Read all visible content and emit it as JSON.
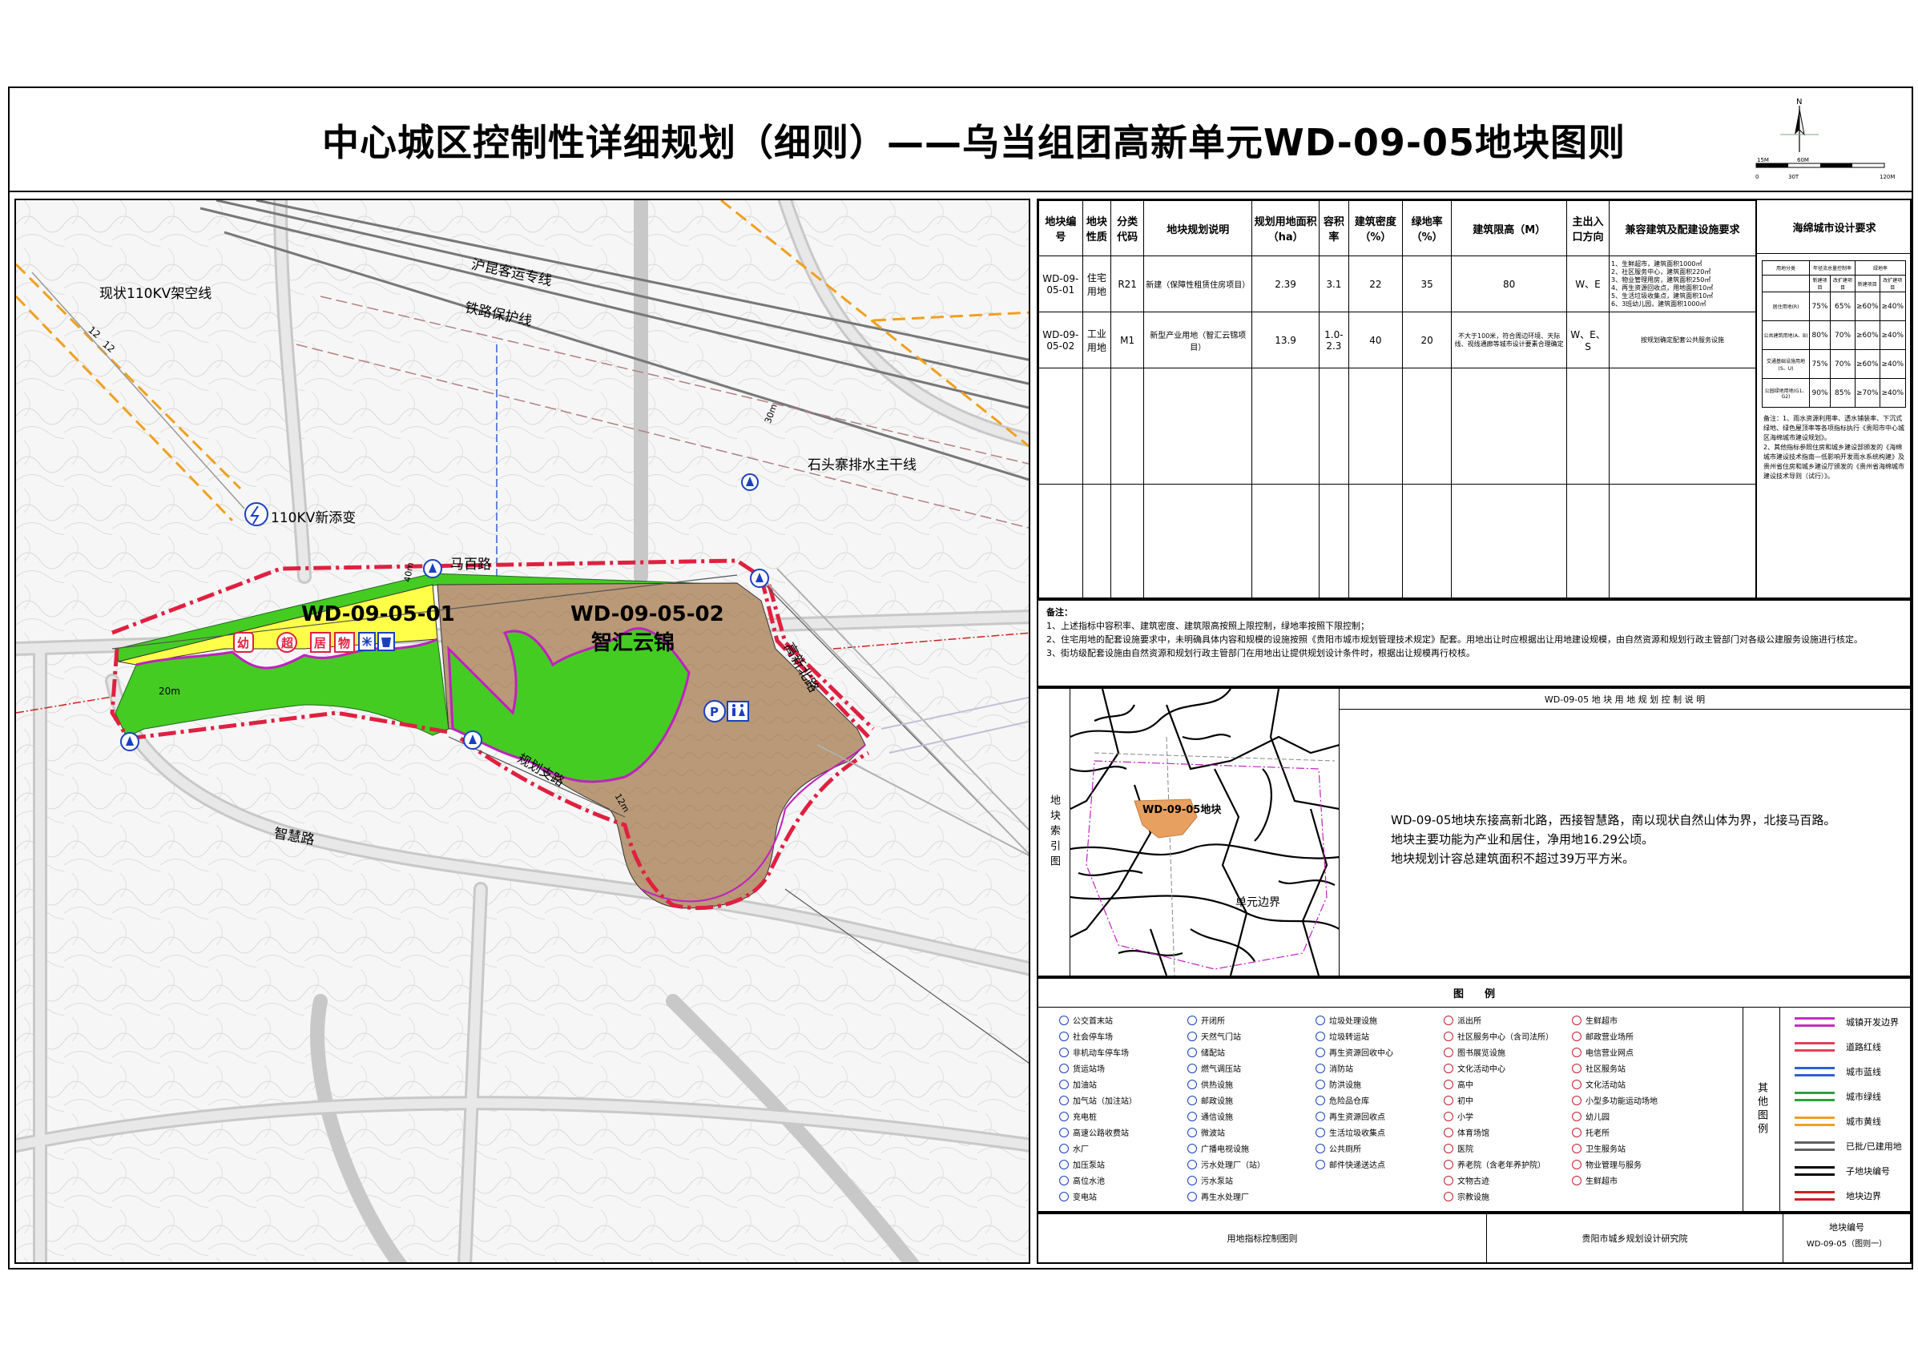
{
  "title": "中心城区控制性详细规划（细则）——乌当组团高新单元WD-09-05地块图则",
  "compass": {
    "north": "N",
    "scale_labels": [
      "15M",
      "60M",
      "0",
      "30T",
      "120M"
    ]
  },
  "map_labels": {
    "railway_passenger": "沪昆客运专线",
    "railway_protection": "铁路保护线",
    "powerline": "现状110KV架空线",
    "powerline_width_a": "12",
    "powerline_width_b": "12",
    "substation": "110KV新添变",
    "drainage": "石头寨排水主干线",
    "road_mabai": "马百路",
    "road_mabai_width": "40m",
    "road_gaoxin": "高新北路",
    "road_gaoxin_width": "30m",
    "road_zhihui": "智慧路",
    "road_zhihui_width": "20m",
    "road_guihua": "规划支路",
    "road_guihua_width": "12m",
    "parcel_01": "WD-09-05-01",
    "parcel_02": "WD-09-05-02",
    "parcel_02_name": "智汇云锦",
    "fac_kindergarten": "幼",
    "fac_supermarket": "超",
    "fac_resident": "居",
    "fac_property": "物",
    "fac_parking": "P",
    "fac_toilet": "🚻"
  },
  "index_table": {
    "headers": [
      "地块编号",
      "地块性质",
      "分类代码",
      "地块规划说明",
      "规划用地面积（ha）",
      "容积率",
      "建筑密度（%）",
      "绿地率（%）",
      "建筑限高（M）",
      "主出入口方向",
      "兼容建筑及配建设施要求",
      "海绵城市设计要求"
    ],
    "rows": [
      [
        "WD-09-05-01",
        "住宅用地",
        "R21",
        "新建（保障性租赁住房项目）",
        "2.39",
        "3.1",
        "22",
        "35",
        "80",
        "W、E"
      ],
      [
        "WD-09-05-02",
        "工业用地",
        "M1",
        "新型产业用地（智汇云锦项目）",
        "13.9",
        "1.0-2.3",
        "40",
        "20",
        "不大于100米，符合周边环境、天际线、视线通廊等城市设计要素合理确定",
        "W、E、S"
      ]
    ],
    "compat_row1": "1、生鲜超市，建筑面积1000㎡\n2、社区服务中心，建筑面积220㎡\n3、物业管理用房，建筑面积250㎡\n4、再生资源回收点，用地面积10㎡\n5、生活垃圾收集点，建筑面积10㎡\n6、3班幼儿园，建筑面积1000㎡",
    "compat_row2": "按规划确定配套公共服务设施",
    "sponge_header": [
      "",
      "年径流总量控制率",
      "",
      "绿地率"
    ],
    "sponge_sub": [
      "用地分类",
      "新建项目",
      "改扩建项目",
      "新建项目",
      "改扩建项目"
    ],
    "sponge_rows": [
      [
        "居住用地(R)",
        "75%",
        "65%",
        "≥60%",
        "≥40%"
      ],
      [
        "公共建筑用地(A、B)",
        "80%",
        "70%",
        "≥60%",
        "≥40%"
      ],
      [
        "交通基础设施用地(S、U)",
        "75%",
        "70%",
        "≥60%",
        "≥40%"
      ],
      [
        "公园绿地用地(G1、G2)",
        "90%",
        "85%",
        "≥70%",
        "≥40%"
      ]
    ],
    "sponge_note": "备注：1、雨水资源利用率、透水铺装率、下沉式绿地、绿色屋顶率等各项指标执行《贵阳市中心城区海绵城市建设规划》。\n2、其他指标参照住房和城乡建设部颁发的《海绵城市建设技术指南—低影响开发雨水系统构建》及贵州省住房和城乡建设厅颁发的《贵州省海绵城市建设技术导则（试行）》。"
  },
  "notes": {
    "heading": "备注：",
    "items": [
      "1、上述指标中容积率、建筑密度、建筑限高按照上限控制，绿地率按照下限控制；",
      "2、住宅用地的配套设施要求中，未明确具体内容和规模的设施按照《贵阳市城市规划管理技术规定》配套。用地出让时应根据出让用地建设规模，由自然资源和规划行政主管部门对各级公建服务设施进行核定。",
      "3、街坊级配套设施由自然资源和规划行政主管部门在用地出让提供规划设计条件时，根据出让规模再行校核。"
    ]
  },
  "index_map": {
    "side_label": "地块索引图",
    "parcel_label": "WD-09-05地块",
    "boundary_label": "单元边界"
  },
  "description": {
    "heading": "WD-09-05 地 块 用 地 规 划 控 制 说 明",
    "lines": [
      "WD-09-05地块东接高新北路，西接智慧路，南以现状自然山体为界，北接马百路。",
      "地块主要功能为产业和居住，净用地16.29公顷。",
      "地块规划计容总建筑面积不超过39万平方米。"
    ]
  },
  "legend": {
    "heading": "图　　例",
    "col1": [
      "公交首末站",
      "社会停车场",
      "非机动车停车场",
      "货运站场",
      "加油站",
      "加气站（加注站）",
      "充电桩",
      "高速公路收费站",
      "水厂",
      "加压泵站",
      "高位水池",
      "变电站"
    ],
    "col2": [
      "开闭所",
      "天然气门站",
      "储配站",
      "燃气调压站",
      "供热设施",
      "邮政设施",
      "通信设施",
      "微波站",
      "广播电视设施",
      "污水处理厂（站）",
      "污水泵站",
      "再生水处理厂"
    ],
    "col3": [
      "垃圾处理设施",
      "垃圾转运站",
      "再生资源回收中心",
      "消防站",
      "防洪设施",
      "危险品仓库",
      "再生资源回收点",
      "生活垃圾收集点",
      "公共厕所",
      "邮件快递送达点"
    ],
    "col4": [
      "派出所",
      "社区服务中心（含司法所）",
      "图书展览设施",
      "文化活动中心",
      "高中",
      "初中",
      "小学",
      "体育场馆",
      "医院",
      "养老院（含老年养护院）",
      "文物古迹",
      "宗教设施"
    ],
    "col5": [
      "生鲜超市",
      "邮政营业场所",
      "电信营业网点",
      "社区服务站",
      "文化活动站",
      "小型多功能运动场地",
      "幼儿园",
      "托老所",
      "卫生服务站",
      "物业管理与服务",
      "生鲜超市"
    ],
    "other_label": "其他图例",
    "lines": [
      {
        "label": "城镇开发边界",
        "color": "#c030c0"
      },
      {
        "label": "道路红线",
        "color": "#e0405a"
      },
      {
        "label": "城市蓝线",
        "color": "#3060d0"
      },
      {
        "label": "城市绿线",
        "color": "#30a040"
      },
      {
        "label": "城市黄线",
        "color": "#f0a020"
      },
      {
        "label": "已批/已建用地",
        "color": "#606060"
      },
      {
        "label": "子地块编号",
        "color": "#000000"
      },
      {
        "label": "地块边界",
        "color": "#d02020"
      }
    ]
  },
  "footer": {
    "left": "用地指标控制图则",
    "middle": "贵阳市城乡规划设计研究院",
    "right_title": "地块编号",
    "right_code": "WD-09-05（图则一）"
  },
  "colors": {
    "residential": "#ffff4a",
    "industrial": "#b99977",
    "green": "#44cc22",
    "road_red": "#e02040",
    "boundary_magenta": "#c020c0"
  }
}
